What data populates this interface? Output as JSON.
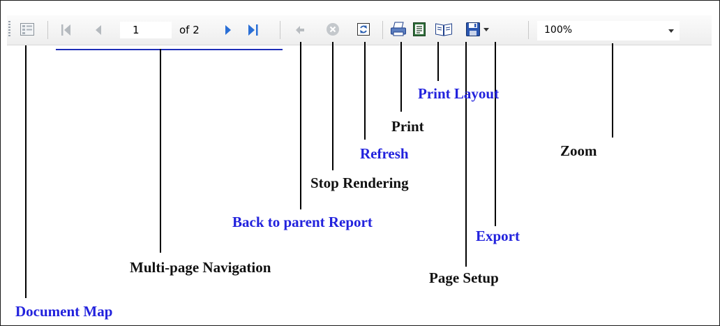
{
  "toolbar": {
    "page_number": "1",
    "page_of": "of 2",
    "zoom": "100%"
  },
  "labels": {
    "document_map": "Document Map",
    "multi_page_navigation": "Multi-page Navigation",
    "back_to_parent_report": "Back to parent Report",
    "stop_rendering": "Stop Rendering",
    "refresh": "Refresh",
    "print": "Print",
    "print_layout": "Print Layout",
    "page_setup": "Page Setup",
    "export": "Export",
    "zoom": "Zoom"
  },
  "colors": {
    "label_blue": "#2222dd",
    "label_black": "#111111",
    "nav_blue": "#2a6fd6",
    "underline_blue": "#1f2fb8"
  }
}
